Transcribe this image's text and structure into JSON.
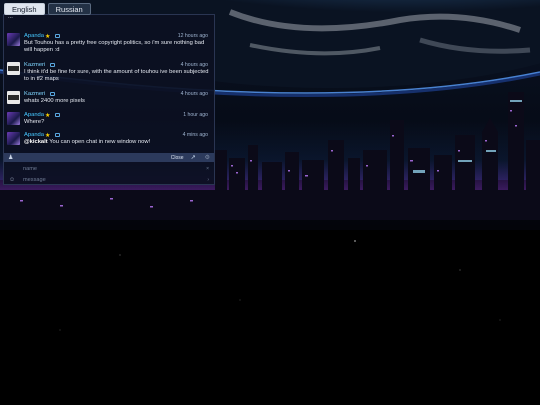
{
  "language_tabs": [
    {
      "label": "English",
      "active": true
    },
    {
      "label": "Russian",
      "active": false
    }
  ],
  "chat": {
    "messages": [
      {
        "user": "",
        "time": "",
        "text": "..."
      },
      {
        "user": "Apanda",
        "star": "★",
        "time": "12 hours ago",
        "text": "But Touhou has a pretty free copyright politics, so i'm sure nothing bad will happen :d"
      },
      {
        "user": "Kazmeri",
        "time": "4 hours ago",
        "text": "I think it'd be fine for sure, with the amount of touhou ive been subjected to in tf2 maps"
      },
      {
        "user": "Kazmeri",
        "time": "4 hours ago",
        "text": "whats 2400 more pixels"
      },
      {
        "user": "Apanda",
        "star": "★",
        "time": "1 hour ago",
        "text": "Where?"
      },
      {
        "user": "Apanda",
        "star": "★",
        "time": "4 mins ago",
        "mention": "@kickalt",
        "text": "You can open chat in new window now!"
      }
    ],
    "toolbar": {
      "close_label": "Close"
    },
    "inputs": {
      "name_placeholder": "name",
      "message_placeholder": "message"
    }
  },
  "colors": {
    "panel_bg": "#0c1022",
    "username": "#46c8ff",
    "toolbar_bg": "#2c3a5c",
    "city_glow": "#b04cff"
  }
}
